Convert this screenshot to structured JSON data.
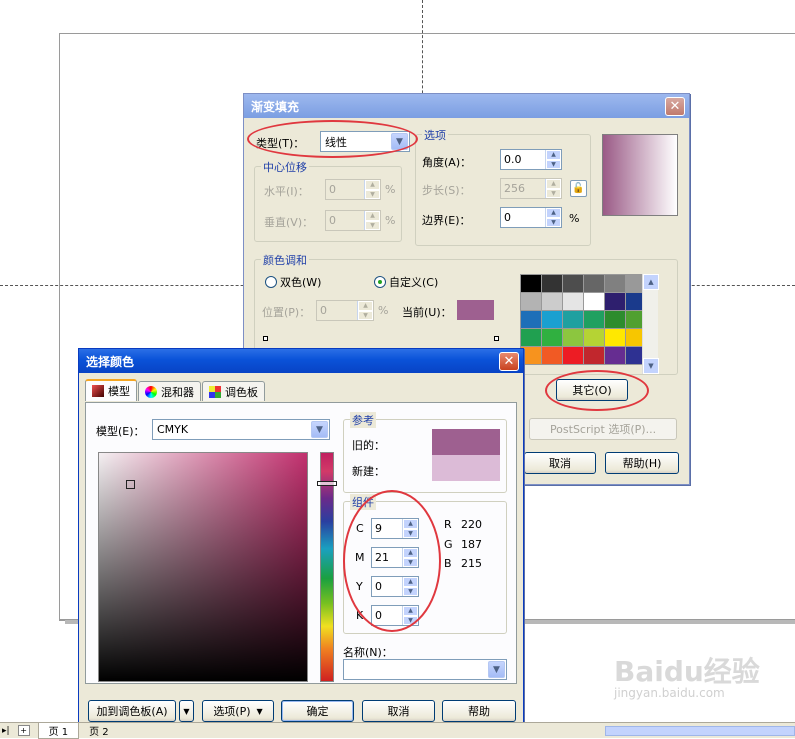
{
  "fountain": {
    "title": "渐变填充",
    "type_label": "类型(T)：",
    "type_value": "线性",
    "center_group": "中心位移",
    "horiz_label": "水平(I)：",
    "horiz_value": "0",
    "vert_label": "垂直(V)：",
    "vert_value": "0",
    "pct": "%",
    "options_group": "选项",
    "angle_label": "角度(A)：",
    "angle_value": "0.0",
    "steps_label": "步长(S)：",
    "steps_value": "256",
    "edge_label": "边界(E)：",
    "edge_value": "0",
    "blend_group": "颜色调和",
    "two_color_label": "双色(W)",
    "custom_label": "自定义(C)",
    "position_label": "位置(P)：",
    "position_value": "0",
    "current_label": "当前(U)：",
    "current_color": "#9e6090",
    "other_button": "其它(O)",
    "postscript_button": "PostScript 选项(P)...",
    "cancel_button": "取消",
    "help_button": "帮助(H)",
    "preview_from": "#9a5a86",
    "preview_to": "#ffffff",
    "palette": [
      "#000000",
      "#333333",
      "#4d4d4d",
      "#666666",
      "#808080",
      "#999999",
      "#b3b3b3",
      "#cccccc",
      "#e5e5e5",
      "#ffffff",
      "#2e1f6e",
      "#1a3a8c",
      "#1e6fb8",
      "#1aa0d0",
      "#1fa0a0",
      "#20a060",
      "#2d8c2d",
      "#50a030",
      "#20a050",
      "#30b040",
      "#8cc63f",
      "#b5d334",
      "#ffe800",
      "#f7c600",
      "#f7931e",
      "#f15a24",
      "#ed1c24",
      "#c1272d",
      "#662d91",
      "#2e3192"
    ]
  },
  "picker": {
    "title": "选择颜色",
    "tabs": [
      "模型",
      "混和器",
      "调色板"
    ],
    "model_label": "模型(E)：",
    "model_value": "CMYK",
    "reference_group": "参考",
    "old_label": "旧的：",
    "old_color": "#9e6090",
    "new_label": "新建：",
    "new_color": "#dcbbd7",
    "components_group": "组件",
    "c_label": "C",
    "c_value": "9",
    "m_label": "M",
    "m_value": "21",
    "y_label": "Y",
    "y_value": "0",
    "k_label": "K",
    "k_value": "0",
    "r_label": "R",
    "r_value": "220",
    "g_label": "G",
    "g_value": "187",
    "b_label": "B",
    "b_value": "215",
    "name_label": "名称(N)：",
    "name_value": "",
    "add_palette_button": "加到调色板(A)",
    "options_button": "选项(P)",
    "ok_button": "确定",
    "cancel_button": "取消",
    "help_button": "帮助"
  },
  "status": {
    "page_label": "页 1",
    "page2_label": "页 2"
  },
  "watermark": {
    "text": "Baidu经验",
    "url": "jingyan.baidu.com"
  },
  "colors": {
    "annotation_ring": "#e0383f",
    "titlebar_active": "#0a52d8"
  }
}
